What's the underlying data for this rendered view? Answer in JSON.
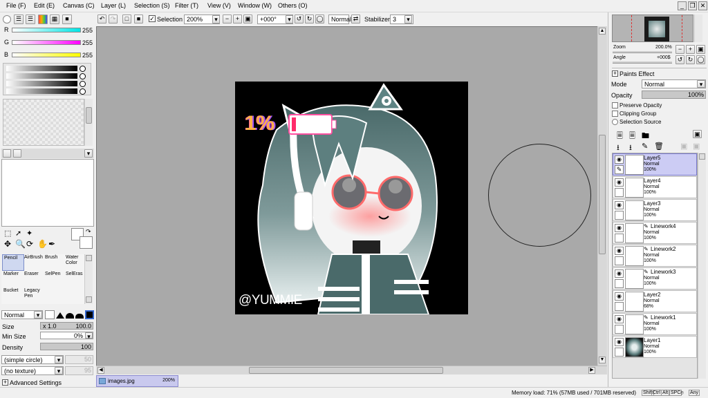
{
  "menu": [
    "File (F)",
    "Edit (E)",
    "Canvas (C)",
    "Layer (L)",
    "Selection (S)",
    "Filter (T)",
    "View (V)",
    "Window (W)",
    "Others (O)"
  ],
  "window_buttons": [
    "_",
    "❐",
    "✕"
  ],
  "toolbar": {
    "selection_label": "Selection",
    "zoom": "200%",
    "angle": "+000°",
    "blend": "Normal",
    "stabilizer_label": "Stabilizer",
    "stabilizer": "3"
  },
  "color": {
    "r_label": "R",
    "r_value": "255",
    "g_label": "G",
    "g_value": "255",
    "b_label": "B",
    "b_value": "255",
    "r_color": "#00e5e5",
    "g_color": "#ff00ff",
    "b_color": "#ffff00"
  },
  "tools": [
    {
      "label": "Pencil",
      "selected": true
    },
    {
      "label": "AirBrush",
      "selected": false
    },
    {
      "label": "Brush",
      "selected": false
    },
    {
      "label": "Water Color",
      "selected": false
    },
    {
      "label": "Marker",
      "selected": false
    },
    {
      "label": "Eraser",
      "selected": false
    },
    {
      "label": "SelPen",
      "selected": false
    },
    {
      "label": "SelEras",
      "selected": false
    },
    {
      "label": "Bucket",
      "selected": false
    },
    {
      "label": "Legacy Pen",
      "selected": false
    }
  ],
  "brush": {
    "mode": "Normal",
    "size_label": "Size",
    "size_mult": "x 1.0",
    "size_value": "100.0",
    "min_size_label": "Min Size",
    "min_size_value": "0%",
    "density_label": "Density",
    "density_value": "100",
    "shape": "(simple circle)",
    "shape_value": "50",
    "texture": "(no texture)",
    "texture_value": "95",
    "advanced": "Advanced Settings"
  },
  "canvas": {
    "watermark": "@YUMMIE",
    "battery_text": "1%",
    "bg_color": "#a9a9a9"
  },
  "navigator": {
    "zoom_label": "Zoom",
    "zoom_value": "200.0%",
    "angle_label": "Angle",
    "angle_value": "+000$"
  },
  "layer_panel": {
    "paints_effect": "Paints Effect",
    "mode_label": "Mode",
    "mode_value": "Normal",
    "opacity_label": "Opacity",
    "opacity_value": "100%",
    "preserve_opacity": "Preserve Opacity",
    "clipping_group": "Clipping Group",
    "selection_source": "Selection Source"
  },
  "layers": [
    {
      "name": "Layer5",
      "mode": "Normal",
      "opacity": "100%",
      "selected": true,
      "linework": false
    },
    {
      "name": "Layer4",
      "mode": "Normal",
      "opacity": "100%",
      "selected": false,
      "linework": false
    },
    {
      "name": "Layer3",
      "mode": "Normal",
      "opacity": "100%",
      "selected": false,
      "linework": false
    },
    {
      "name": "Linework4",
      "mode": "Normal",
      "opacity": "100%",
      "selected": false,
      "linework": true
    },
    {
      "name": "Linework2",
      "mode": "Normal",
      "opacity": "100%",
      "selected": false,
      "linework": true
    },
    {
      "name": "Linework3",
      "mode": "Normal",
      "opacity": "100%",
      "selected": false,
      "linework": true
    },
    {
      "name": "Layer2",
      "mode": "Normal",
      "opacity": "68%",
      "selected": false,
      "linework": false
    },
    {
      "name": "Linework1",
      "mode": "Normal",
      "opacity": "100%",
      "selected": false,
      "linework": true
    },
    {
      "name": "Layer1",
      "mode": "Normal",
      "opacity": "100%",
      "selected": false,
      "linework": false
    }
  ],
  "tab": {
    "name": "images.jpg",
    "zoom": "200%"
  },
  "status": {
    "memory": "Memory load: 71% (57MB used / 701MB reserved)",
    "keys": [
      "Shift",
      "Ctrl",
      "Alt",
      "SPC",
      "⌾",
      "Any"
    ]
  }
}
